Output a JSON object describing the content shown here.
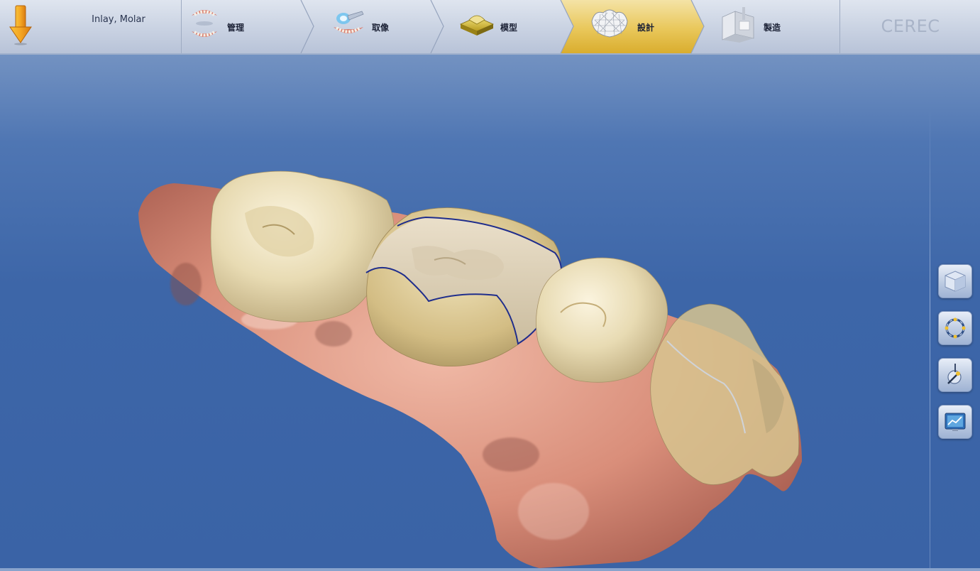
{
  "app": {
    "brand": "CEREC"
  },
  "job": {
    "label": "Inlay, Molar",
    "icon": "orange-down-arrow-icon"
  },
  "workflow": {
    "steps": [
      {
        "id": "admin",
        "label": "管理",
        "icon": "jaw-arches-icon",
        "active": false
      },
      {
        "id": "acquisition",
        "label": "取像",
        "icon": "scan-camera-icon",
        "active": false
      },
      {
        "id": "model",
        "label": "模型",
        "icon": "model-die-icon",
        "active": false
      },
      {
        "id": "design",
        "label": "設計",
        "icon": "crown-wireframe-icon",
        "active": true
      },
      {
        "id": "manufacture",
        "label": "製造",
        "icon": "milling-unit-icon",
        "active": false
      }
    ]
  },
  "side_tools": [
    {
      "id": "view-options",
      "icon": "cube-icon"
    },
    {
      "id": "rotate",
      "icon": "rotate-ring-icon"
    },
    {
      "id": "tools",
      "icon": "probe-tool-icon"
    },
    {
      "id": "screenshot",
      "icon": "monitor-chart-icon"
    }
  ],
  "colors": {
    "accent_active": "#e8c24a",
    "margin_line": "#1f2d8c",
    "background": "#3d66a8"
  }
}
